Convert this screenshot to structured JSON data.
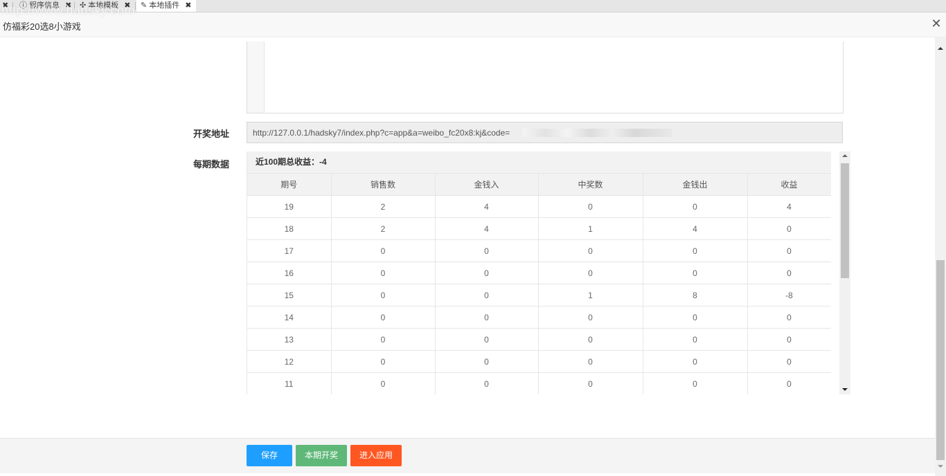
{
  "tabs": [
    {
      "label": "程序信息",
      "icon": "info-icon"
    },
    {
      "label": "本地模板",
      "icon": "puzzle-icon"
    },
    {
      "label": "本地插件",
      "icon": "plug-icon"
    }
  ],
  "tab_close": "✖",
  "watermark": "http://www.hadsky.com",
  "dialog": {
    "title": "仿福彩20选8小游戏",
    "close_glyph": "✕"
  },
  "form": {
    "draw_url_label": "开奖地址",
    "draw_url_value": "http://127.0.0.1/hadsky7/index.php?c=app&a=weibo_fc20x8:kj&code=",
    "period_data_label": "每期数据"
  },
  "summary": "近100期总收益：-4",
  "table": {
    "headers": [
      "期号",
      "销售数",
      "金钱入",
      "中奖数",
      "金钱出",
      "收益"
    ],
    "rows": [
      [
        "19",
        "2",
        "4",
        "0",
        "0",
        "4"
      ],
      [
        "18",
        "2",
        "4",
        "1",
        "4",
        "0"
      ],
      [
        "17",
        "0",
        "0",
        "0",
        "0",
        "0"
      ],
      [
        "16",
        "0",
        "0",
        "0",
        "0",
        "0"
      ],
      [
        "15",
        "0",
        "0",
        "1",
        "8",
        "-8"
      ],
      [
        "14",
        "0",
        "0",
        "0",
        "0",
        "0"
      ],
      [
        "13",
        "0",
        "0",
        "0",
        "0",
        "0"
      ],
      [
        "12",
        "0",
        "0",
        "0",
        "0",
        "0"
      ],
      [
        "11",
        "0",
        "0",
        "0",
        "0",
        "0"
      ]
    ]
  },
  "buttons": {
    "save": "保存",
    "draw": "本期开奖",
    "enter": "进入应用"
  },
  "colors": {
    "save": "#1e9fff",
    "draw": "#5fb878",
    "enter": "#ff5722"
  }
}
